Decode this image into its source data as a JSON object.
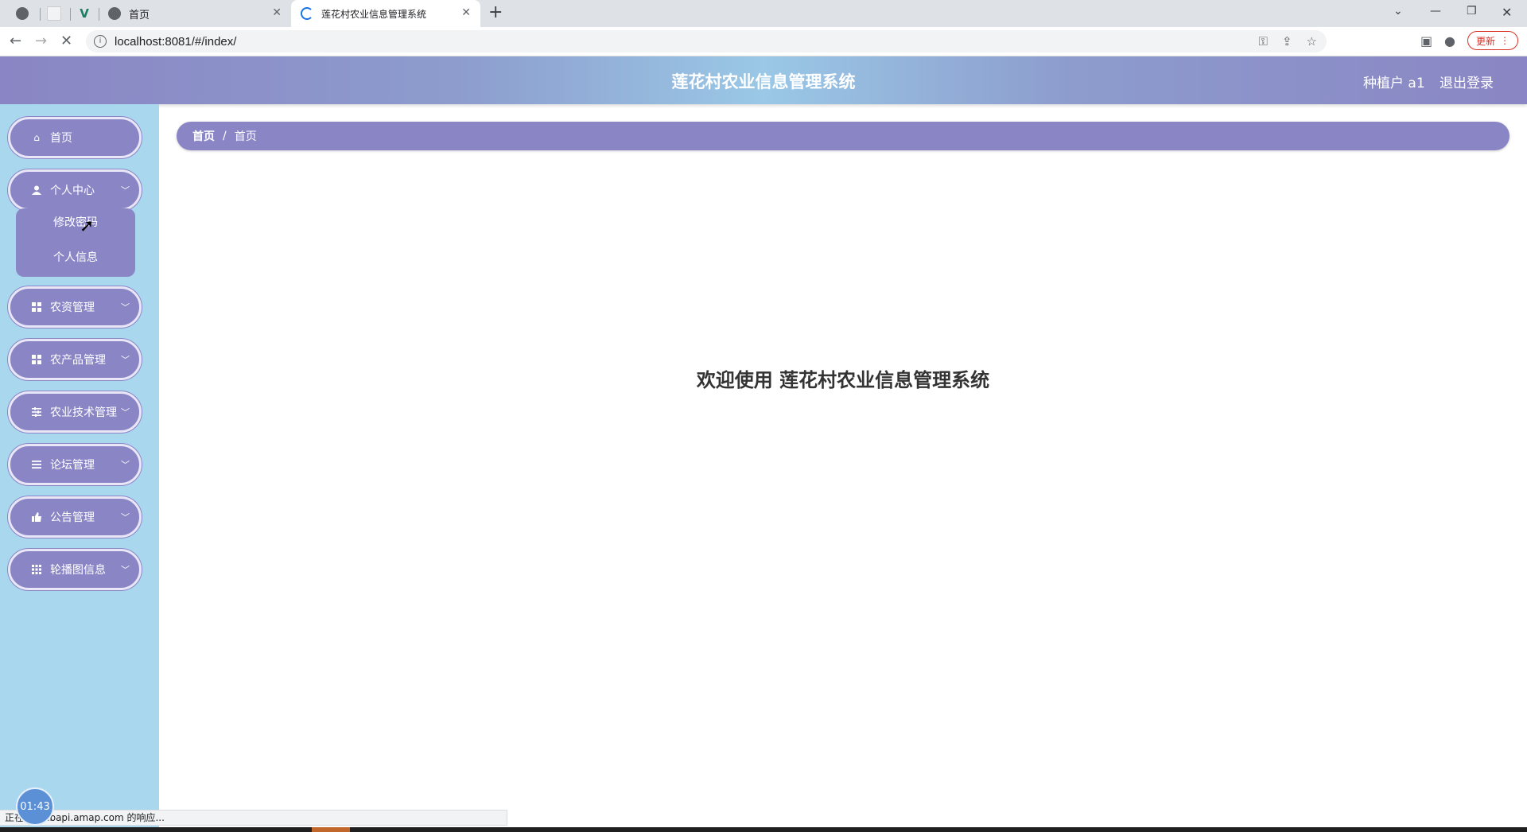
{
  "browser": {
    "tabs": [
      {
        "label": "",
        "icon": "globe-icon"
      },
      {
        "label": "",
        "icon": "page-icon"
      },
      {
        "label": "",
        "icon": "vue-icon"
      },
      {
        "label": "首页",
        "icon": "globe-icon"
      },
      {
        "label": "莲花村农业信息管理系统",
        "icon": "loading-icon",
        "active": true
      }
    ],
    "url": "localhost:8081/#/index/",
    "update_label": "更新",
    "status_text": "正在... webapi.amap.com 的响应..."
  },
  "header": {
    "title": "莲花村农业信息管理系统",
    "user": "种植户 a1",
    "logout": "退出登录"
  },
  "sidebar": {
    "items": [
      {
        "label": "首页",
        "icon": "home-icon"
      },
      {
        "label": "个人中心",
        "icon": "user-icon",
        "expanded": true,
        "children": [
          {
            "label": "修改密码"
          },
          {
            "label": "个人信息"
          }
        ]
      },
      {
        "label": "农资管理",
        "icon": "grid-icon"
      },
      {
        "label": "农产品管理",
        "icon": "grid-icon"
      },
      {
        "label": "农业技术管理",
        "icon": "sliders-icon"
      },
      {
        "label": "论坛管理",
        "icon": "list-icon"
      },
      {
        "label": "公告管理",
        "icon": "thumbs-up-icon"
      },
      {
        "label": "轮播图信息",
        "icon": "apps-icon"
      }
    ]
  },
  "breadcrumb": [
    "首页",
    "首页"
  ],
  "main": {
    "welcome": "欢迎使用 莲花村农业信息管理系统"
  },
  "overlay": {
    "clock": "01:43"
  },
  "colors": {
    "menu_bg": "#8a86c6",
    "sidebar_bg": "#a9d7ee",
    "header_gradient_center": "#9ac8e6",
    "header_gradient_edge": "#8a85c4"
  }
}
